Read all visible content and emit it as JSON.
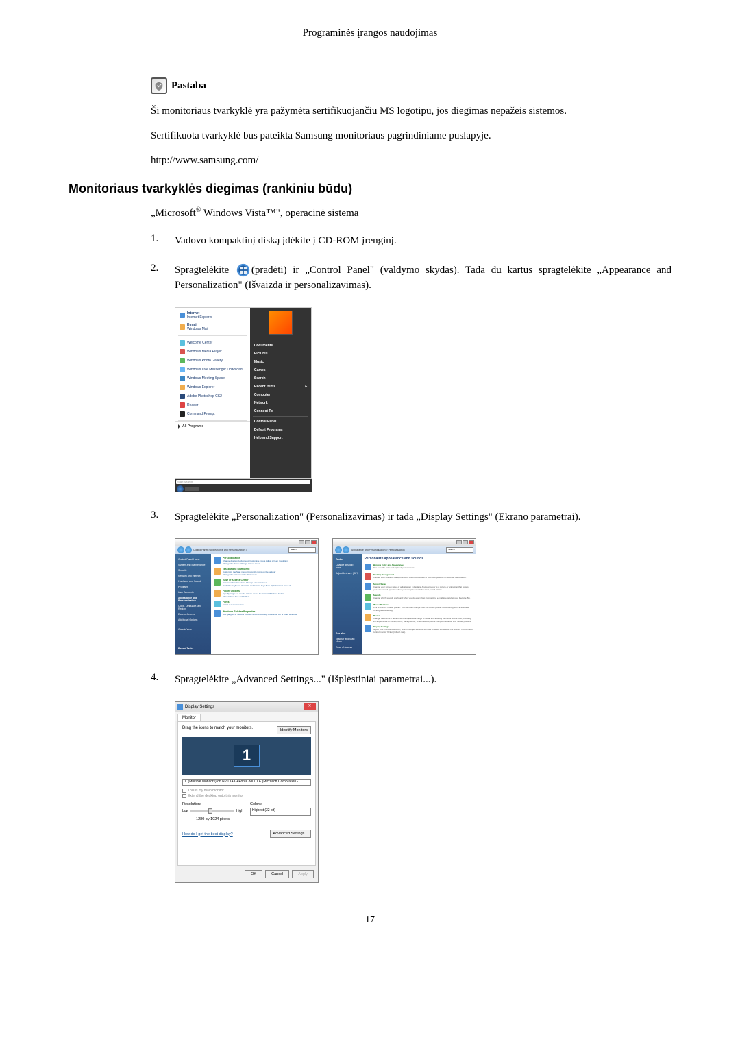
{
  "header_title": "Programinės įrangos naudojimas",
  "note": {
    "label": "Pastaba",
    "p1": "Ši monitoriaus tvarkyklė yra pažymėta sertifikuojančiu MS logotipu, jos diegimas nepažeis sistemos.",
    "p2": "Sertifikuota tvarkyklė bus pateikta Samsung monitoriaus pagrindiniame puslapyje.",
    "url": "http://www.samsung.com/"
  },
  "section_heading": "Monitoriaus tvarkyklės diegimas (rankiniu būdu)",
  "os_text_before": "„Microsoft",
  "os_text_reg": "®",
  "os_text_mid": " Windows Vista™\", operacinė sistema",
  "steps": [
    {
      "num": "1.",
      "text": "Vadovo kompaktinį diską įdėkite į CD-ROM įrenginį."
    },
    {
      "num": "2.",
      "text_before": "Spragtelėkite ",
      "text_after": "(pradėti) ir „Control Panel\" (valdymo skydas). Tada du kartus spragtelėkite „Appearance and Personalization\" (Išvaizda ir personalizavimas)."
    },
    {
      "num": "3.",
      "text": "Spragtelėkite „Personalization\" (Personalizavimas) ir tada „Display Settings\" (Ekrano parametrai)."
    },
    {
      "num": "4.",
      "text": "Spragtelėkite „Advanced Settings...\" (Išplėstiniai parametrai...)."
    }
  ],
  "startmenu": {
    "items": [
      "Internet",
      "Internet Explorer",
      "E-mail",
      "Windows Mail",
      "Welcome Center",
      "Windows Media Player",
      "Windows Photo Gallery",
      "Windows Live Messenger Download",
      "Windows Meeting Space",
      "Windows Explorer",
      "Adobe Photoshop CS2",
      "Reader",
      "Command Prompt"
    ],
    "allprograms": "All Programs",
    "search": "Start Search",
    "right_items": [
      "Documents",
      "Pictures",
      "Music",
      "Games",
      "Search",
      "Recent Items",
      "Computer",
      "Network",
      "Connect To",
      "Control Panel",
      "Default Programs",
      "Help and Support"
    ]
  },
  "panel_left": {
    "breadcrumb": "Control Panel > Appearance and Personalization >",
    "search_placeholder": "Search",
    "sidebar": [
      "Control Panel Home",
      "System and Maintenance",
      "Security",
      "Network and Internet",
      "Hardware and Sound",
      "Programs",
      "User Accounts",
      "Appearance and Personalization",
      "Clock, Language, and Region",
      "Ease of Access",
      "Additional Options",
      "Classic View"
    ],
    "content": [
      {
        "title": "Personalization",
        "sub": "Change desktop background   Customize colors   Adjust screen resolution",
        "sub2": "Change the theme   Change screen saver"
      },
      {
        "title": "Taskbar and Start Menu",
        "sub": "Customize the Start menu   Customize icons on the taskbar",
        "sub2": "Change the picture on the Start menu"
      },
      {
        "title": "Ease of Access Center",
        "sub": "Accommodate low vision   Change screen reader",
        "sub2": "Underline keyboard shortcuts and access keys   Turn High Contrast on or off"
      },
      {
        "title": "Folder Options",
        "sub": "Specify single- or double-click to open   Use Classic Windows folders",
        "sub2": "Show hidden files and folders"
      },
      {
        "title": "Fonts",
        "sub": "Install or remove a font"
      },
      {
        "title": "Windows Sidebar Properties",
        "sub": "Add gadgets to Sidebar   Choose whether to keep Sidebar on top of other windows"
      }
    ],
    "recent": "Recent Tasks"
  },
  "panel_right": {
    "breadcrumb": "Appearance and Personalization > Personalization",
    "search_placeholder": "Search",
    "sidebar": [
      "Tasks",
      "Change desktop icons",
      "Adjust font size (DPI)"
    ],
    "heading": "Personalize appearance and sounds",
    "content": [
      {
        "title": "Window Color and Appearance",
        "desc": "Fine tune the color and style of your windows."
      },
      {
        "title": "Desktop Background",
        "desc": "Choose from available backgrounds or colors or use one of your own pictures to decorate the desktop."
      },
      {
        "title": "Screen Saver",
        "desc": "Change your screen saver or adjust when it displays. A screen saver is a picture or animation that covers your screen and appears when your computer is idle for a set period of time."
      },
      {
        "title": "Sounds",
        "desc": "Change which sounds are heard when you do everything from getting e-mail to emptying your Recycle Bin."
      },
      {
        "title": "Mouse Pointers",
        "desc": "Pick a different mouse pointer. You can also change how the mouse pointer looks during such activities as clicking and selecting."
      },
      {
        "title": "Theme",
        "desc": "Change the theme. Themes can change a wide range of visual and auditory elements at one time, including the appearance of menus, icons, backgrounds, screen savers, some computer sounds, and mouse pointers."
      },
      {
        "title": "Display Settings",
        "desc": "Adjust your monitor resolution, which changes the view so more or fewer items fit on the screen. You can also control monitor flicker (refresh rate)."
      }
    ],
    "seealso": "See also",
    "seealso_items": [
      "Taskbar and Start Menu",
      "Ease of Access"
    ]
  },
  "display_dialog": {
    "title": "Display Settings",
    "tab": "Monitor",
    "drag_text": "Drag the icons to match your monitors.",
    "identify_btn": "Identify Monitors",
    "monitor_num": "1",
    "dropdown": "1. (Multiple Monitors) on NVIDIA GeForce 8800 LE (Microsoft Corporation - ...",
    "cb1": "This is my main monitor",
    "cb2": "Extend the desktop onto this monitor",
    "resolution_label": "Resolution:",
    "slider_low": "Low",
    "slider_high": "High",
    "resolution_value": "1280 by 1024 pixels",
    "colors_label": "Colors:",
    "colors_value": "Highest (32 bit)",
    "link": "How do I get the best display?",
    "adv_btn": "Advanced Settings...",
    "ok": "OK",
    "cancel": "Cancel",
    "apply": "Apply"
  },
  "page_number": "17"
}
